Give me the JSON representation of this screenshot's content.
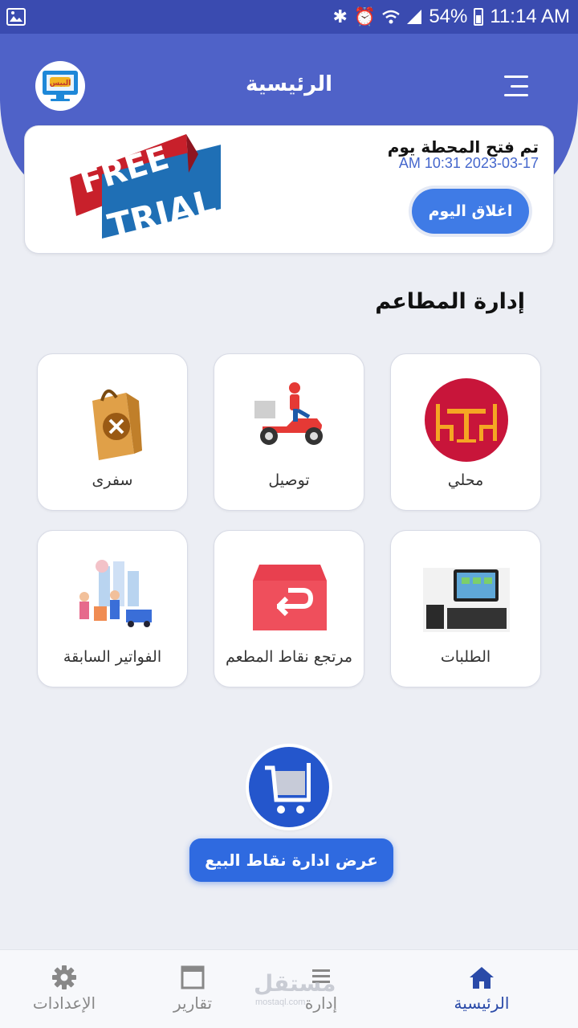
{
  "status_bar": {
    "battery": "54%",
    "time": "11:14 AM"
  },
  "header": {
    "title": "الرئيسية",
    "logo_text": "البيس"
  },
  "trial_card": {
    "badge_line1": "FREE",
    "badge_line2": "TRIAL",
    "station_message": "تم فتح المحطة يوم",
    "opened_at": "AM 10:31 2023-03-17",
    "close_day_label": "اغلاق اليوم"
  },
  "section": {
    "title": "إدارة المطاعم"
  },
  "tiles": [
    {
      "label": "محلي",
      "icon": "dine-in-table-icon"
    },
    {
      "label": "توصيل",
      "icon": "delivery-scooter-icon"
    },
    {
      "label": "سفرى",
      "icon": "takeaway-bag-icon"
    },
    {
      "label": "الطلبات",
      "icon": "pos-terminal-icon"
    },
    {
      "label": "مرتجع نقاط المطعم",
      "icon": "return-box-icon"
    },
    {
      "label": "الفواتير السابقة",
      "icon": "previous-invoices-icon"
    }
  ],
  "pos": {
    "button_label": "عرض ادارة نقاط البيع",
    "icon": "shopping-cart-icon"
  },
  "bottom_nav": [
    {
      "label": "الرئيسية",
      "icon": "home-icon",
      "active": true
    },
    {
      "label": "إدارة",
      "icon": "list-icon",
      "active": false
    },
    {
      "label": "تقارير",
      "icon": "report-icon",
      "active": false
    },
    {
      "label": "الإعدادات",
      "icon": "gear-icon",
      "active": false
    }
  ],
  "watermark": {
    "text": "مستقل",
    "sub": "mostaql.com"
  },
  "colors": {
    "header": "#4f62c8",
    "status_bar": "#3a4bb0",
    "accent_button": "#3f7be6",
    "active_nav": "#2a4aa8"
  }
}
